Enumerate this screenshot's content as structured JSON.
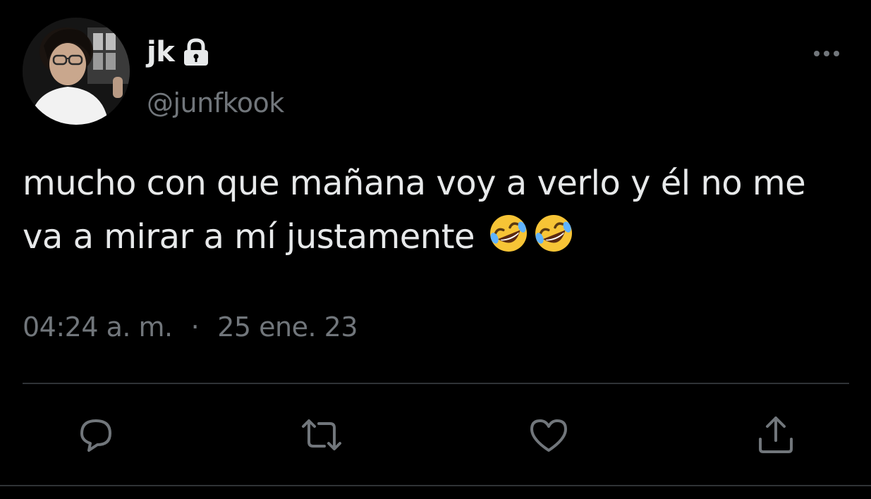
{
  "author": {
    "display_name": "jk",
    "handle": "@junfkook",
    "protected": true,
    "lock_icon": "lock-icon",
    "avatar": "profile-photo"
  },
  "tweet": {
    "text": "mucho con que mañana voy a verlo y él no me va a mirar a mí justamente",
    "emojis": [
      "🤣",
      "🤣"
    ],
    "time": "04:24 a. m.",
    "separator": "·",
    "date": "25 ene. 23"
  },
  "actions": {
    "reply_icon": "reply-icon",
    "retweet_icon": "retweet-icon",
    "like_icon": "heart-icon",
    "share_icon": "share-icon",
    "more_icon": "more-icon"
  },
  "colors": {
    "background": "#000000",
    "text_primary": "#e7e9ea",
    "text_secondary": "#71767b",
    "divider": "#2f3336"
  }
}
